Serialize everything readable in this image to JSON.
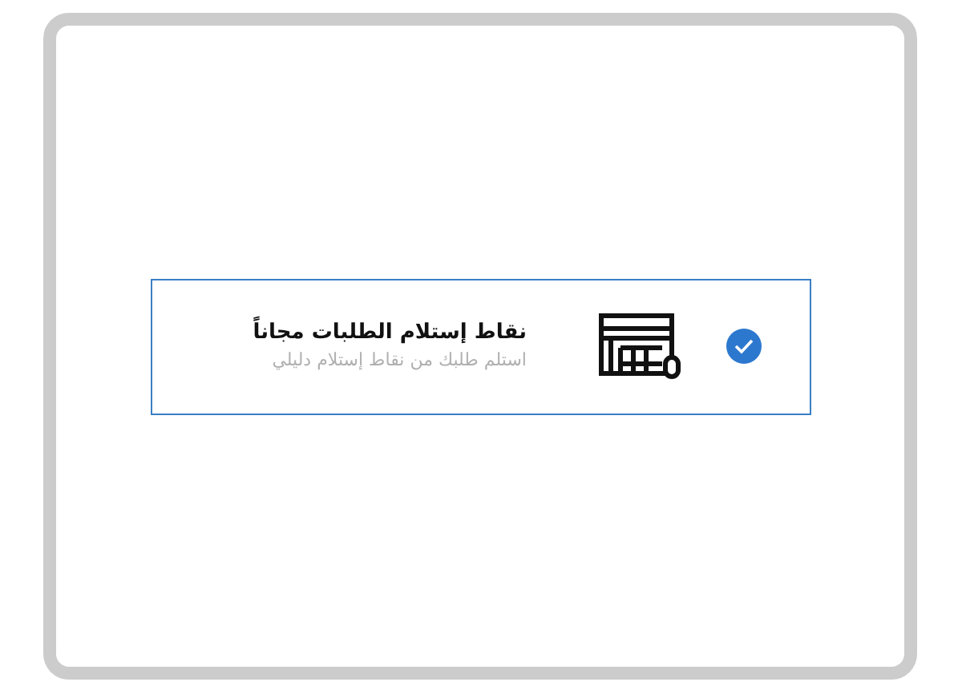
{
  "option": {
    "title": "نقاط إستلام الطلبات مجاناً",
    "subtitle": "استلم طلبك من نقاط إستلام دليلي",
    "selected": true
  }
}
